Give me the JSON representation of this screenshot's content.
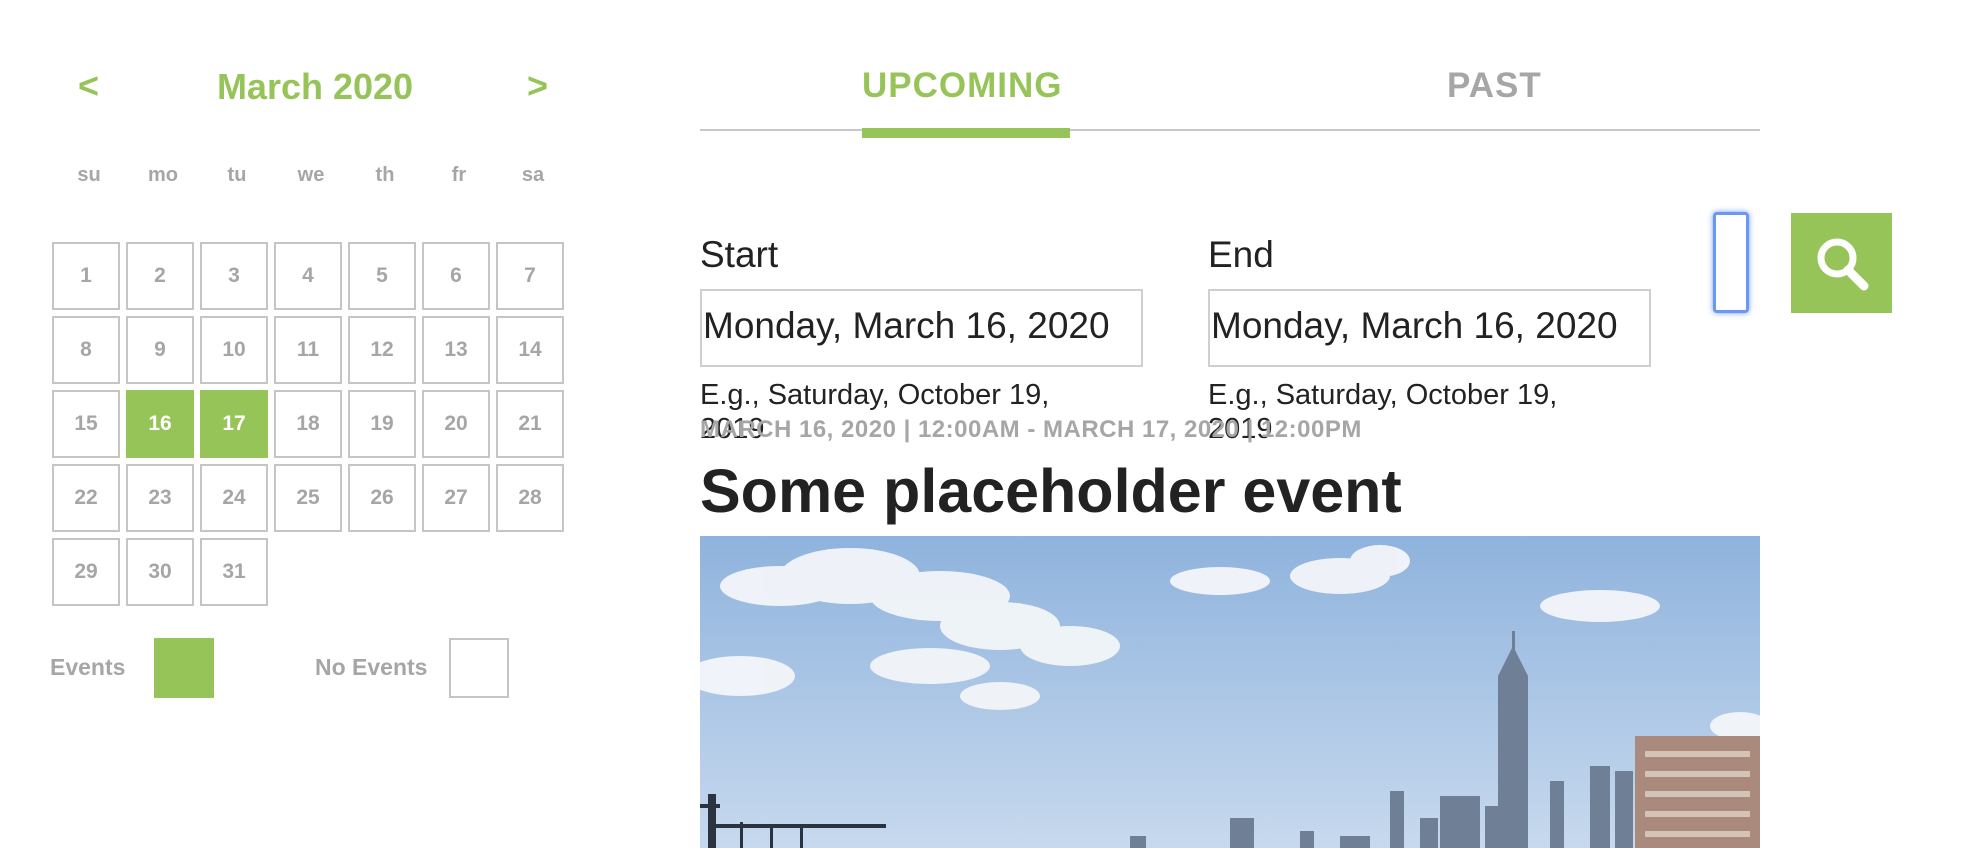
{
  "calendar": {
    "prev_label": "<",
    "next_label": ">",
    "month_title": "March 2020",
    "weekdays": [
      "su",
      "mo",
      "tu",
      "we",
      "th",
      "fr",
      "sa"
    ],
    "days": [
      "1",
      "2",
      "3",
      "4",
      "5",
      "6",
      "7",
      "8",
      "9",
      "10",
      "11",
      "12",
      "13",
      "14",
      "15",
      "16",
      "17",
      "18",
      "19",
      "20",
      "21",
      "22",
      "23",
      "24",
      "25",
      "26",
      "27",
      "28",
      "29",
      "30",
      "31"
    ],
    "event_days": [
      "16",
      "17"
    ],
    "legend": {
      "events_label": "Events",
      "no_events_label": "No Events"
    }
  },
  "tabs": {
    "upcoming": "UPCOMING",
    "past": "PAST",
    "active": "upcoming"
  },
  "filters": {
    "start_label": "Start",
    "end_label": "End",
    "start_value": "Monday, March 16, 2020",
    "end_value": "Monday, March 16, 2020",
    "start_hint": "E.g., Saturday, October 19, 2019",
    "end_hint": "E.g., Saturday, October 19, 2019",
    "search_icon": "search-icon"
  },
  "event": {
    "date_range": "MARCH 16, 2020 | 12:00AM - MARCH 17, 2020 | 12:00PM",
    "title": "Some placeholder event"
  },
  "colors": {
    "accent": "#97c459",
    "muted": "#a6a6a6",
    "text": "#222222",
    "focus": "#6a98f2"
  }
}
